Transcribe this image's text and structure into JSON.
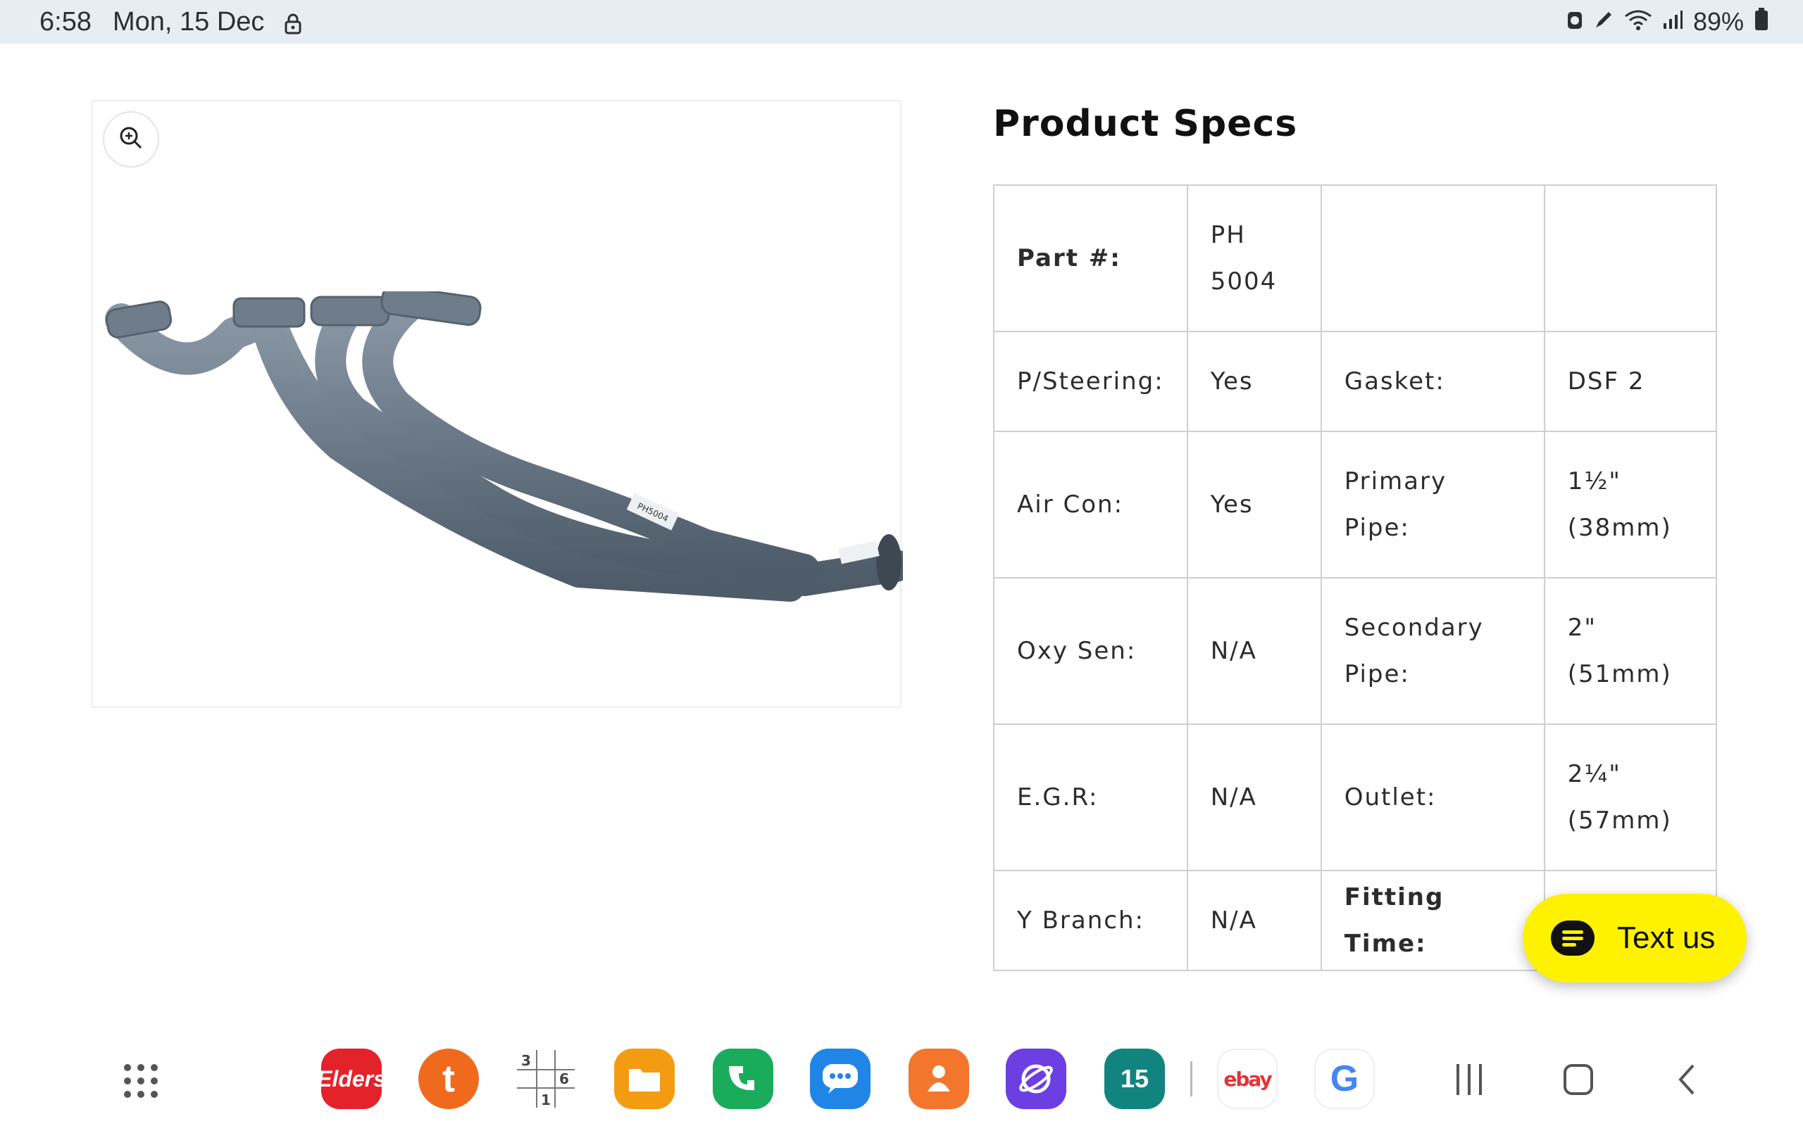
{
  "status_bar": {
    "time": "6:58",
    "date": "Mon, 15 Dec",
    "battery": "89%",
    "icons": [
      "lock-icon",
      "alarm-icon",
      "pen-icon",
      "wifi-icon",
      "signal-icon",
      "battery-icon"
    ]
  },
  "product_image": {
    "icon": "zoom-in-icon",
    "part_label": "PH5004"
  },
  "specs": {
    "title": "Product Specs",
    "rows": [
      [
        "Part #:",
        "PH\n5004",
        "",
        ""
      ],
      [
        "P/Steering:",
        "Yes",
        "Gasket:",
        "DSF 2"
      ],
      [
        "Air Con:",
        "Yes",
        "Primary Pipe:",
        "1½\"\n(38mm)"
      ],
      [
        "Oxy Sen:",
        "N/A",
        "Secondary\nPipe:",
        "2\" (51mm)"
      ],
      [
        "E.G.R:",
        "N/A",
        "Outlet:",
        "2¼\"\n(57mm)"
      ],
      [
        "Y Branch:",
        "N/A",
        "Fitting Time:",
        ""
      ]
    ]
  },
  "chat": {
    "label": "Text us",
    "icon": "chat-bubble-icon"
  },
  "taskbar": {
    "apps": [
      {
        "name": "elders",
        "label": "Elders",
        "color": "#e4222a"
      },
      {
        "name": "tradie",
        "label": "t",
        "color": "#f06a1d"
      },
      {
        "name": "sudoku",
        "label": "",
        "color": "#ffffff"
      },
      {
        "name": "files",
        "label": "",
        "color": "#f39c12"
      },
      {
        "name": "phone",
        "label": "",
        "color": "#1aab5b"
      },
      {
        "name": "messages",
        "label": "",
        "color": "#1f86e8"
      },
      {
        "name": "contacts",
        "label": "",
        "color": "#f3762c"
      },
      {
        "name": "internet",
        "label": "",
        "color": "#6b3fe2"
      },
      {
        "name": "calendar",
        "label": "15",
        "color": "#12847f"
      },
      {
        "name": "ebay",
        "label": "ebay",
        "color": "#ffffff"
      },
      {
        "name": "google",
        "label": "G",
        "color": "#ffffff"
      }
    ],
    "nav": [
      "recents-icon",
      "home-icon",
      "back-icon"
    ]
  },
  "colors": {
    "accent_yellow": "#fff200",
    "table_border": "#cfcfcf",
    "pipe_gray": "#6e7d8c"
  }
}
